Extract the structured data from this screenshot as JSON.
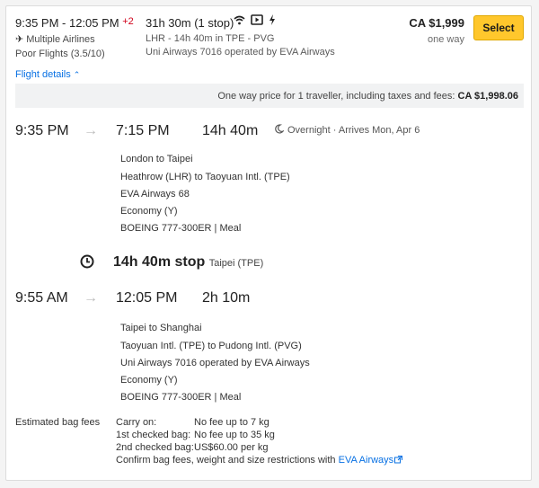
{
  "summary": {
    "depart_arrive": "9:35 PM - 12:05 PM",
    "day_offset": "+2",
    "airline": "Multiple Airlines",
    "rating": "Poor Flights (3.5/10)",
    "duration": "31h 30m (1 stop)",
    "route": "LHR - 14h 40m in TPE - PVG",
    "operated": "Uni Airways 7016 operated by EVA Airways",
    "price": "CA $1,999",
    "price_type": "one way",
    "select_label": "Select",
    "amenities": [
      "wifi-icon",
      "video-icon",
      "power-icon"
    ]
  },
  "details_link": "Flight details",
  "fare_note": {
    "prefix": "One way price for 1 traveller, including taxes and fees:",
    "amount": "CA $1,998.06"
  },
  "segment1": {
    "depart": "9:35 PM",
    "arrive": "7:15 PM",
    "duration": "14h 40m",
    "overnight": "Overnight · Arrives Mon, Apr 6",
    "lines": [
      "London to Taipei",
      "Heathrow (LHR) to Taoyuan Intl. (TPE)",
      "EVA Airways 68",
      "Economy (Y)",
      "BOEING 777-300ER | Meal"
    ]
  },
  "stop": {
    "duration": "14h 40m stop",
    "city": "Taipei (TPE)"
  },
  "segment2": {
    "depart": "9:55 AM",
    "arrive": "12:05 PM",
    "duration": "2h 10m",
    "lines": [
      "Taipei to Shanghai",
      "Taoyuan Intl. (TPE) to Pudong Intl. (PVG)",
      "Uni Airways 7016 operated by EVA Airways",
      "Economy (Y)",
      "BOEING 777-300ER | Meal"
    ]
  },
  "bags": {
    "label": "Estimated bag fees",
    "rows": [
      {
        "type": "Carry on:",
        "fee": "No fee up to 7 kg"
      },
      {
        "type": "1st checked bag:",
        "fee": "No fee up to 35 kg"
      },
      {
        "type": "2nd checked bag:",
        "fee": "US$60.00 per kg"
      }
    ],
    "confirm_text": "Confirm bag fees, weight and size restrictions with",
    "confirm_link": "EVA Airways"
  },
  "colors": {
    "accent": "#0770e3",
    "select": "#ffc72c",
    "day_offset": "#d0021b"
  }
}
